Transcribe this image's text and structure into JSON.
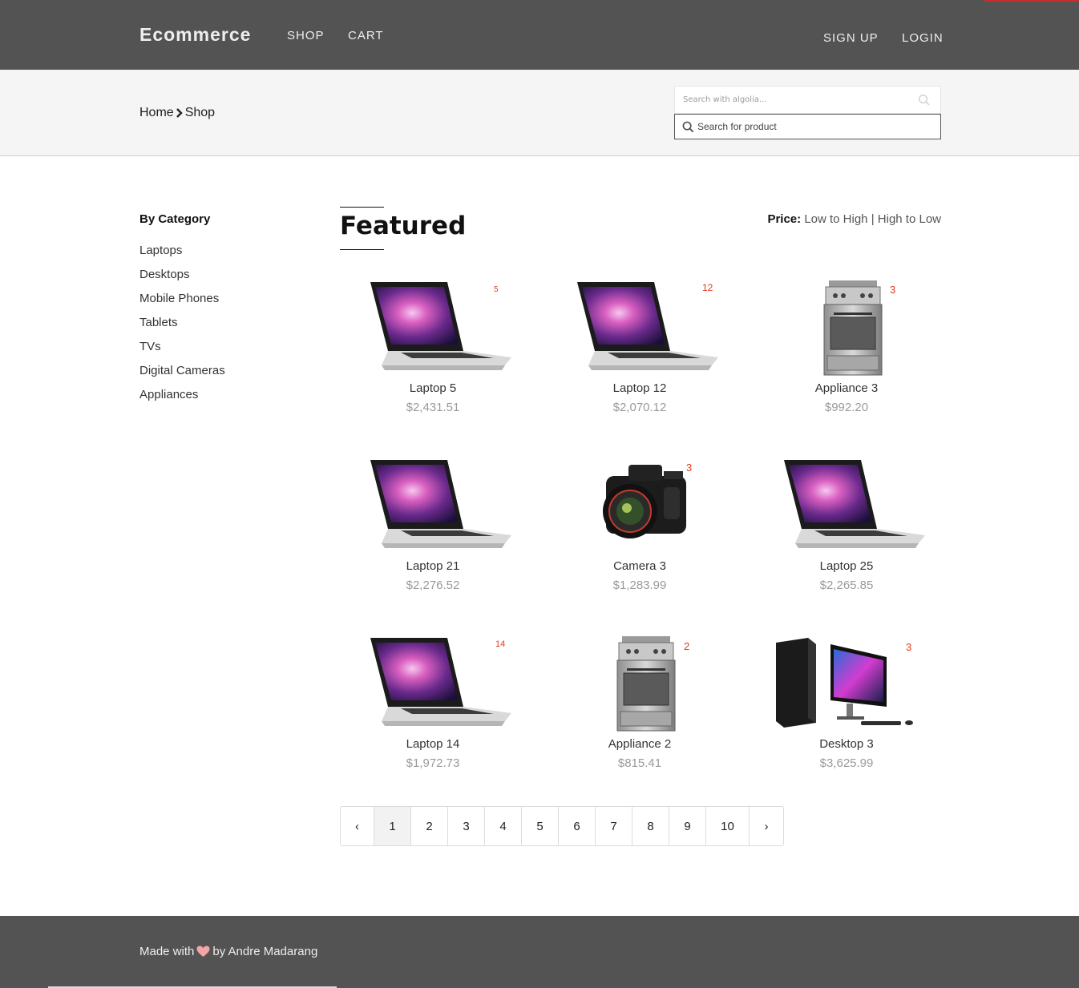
{
  "nav": {
    "brand": "Ecommerce",
    "shop": "SHOP",
    "cart": "CART",
    "signup": "SIGN UP",
    "login": "LOGIN"
  },
  "breadcrumb": {
    "home": "Home",
    "current": "Shop"
  },
  "search": {
    "algolia_placeholder": "Search with algolia...",
    "product_placeholder": "Search for product"
  },
  "sidebar": {
    "title": "By Category",
    "categories": [
      "Laptops",
      "Desktops",
      "Mobile Phones",
      "Tablets",
      "TVs",
      "Digital Cameras",
      "Appliances"
    ]
  },
  "main": {
    "heading": "Featured",
    "sort_label": "Price:",
    "sort_low": "Low to High",
    "sort_sep": "|",
    "sort_high": "High to Low"
  },
  "products": [
    {
      "name": "Laptop 5",
      "price": "$2,431.51",
      "badge": "5",
      "kind": "laptop"
    },
    {
      "name": "Laptop 12",
      "price": "$2,070.12",
      "badge": "12",
      "kind": "laptop"
    },
    {
      "name": "Appliance 3",
      "price": "$992.20",
      "badge": "3",
      "kind": "stove"
    },
    {
      "name": "Laptop 21",
      "price": "$2,276.52",
      "badge": "",
      "kind": "laptop"
    },
    {
      "name": "Camera 3",
      "price": "$1,283.99",
      "badge": "3",
      "kind": "camera"
    },
    {
      "name": "Laptop 25",
      "price": "$2,265.85",
      "badge": "",
      "kind": "laptop"
    },
    {
      "name": "Laptop 14",
      "price": "$1,972.73",
      "badge": "14",
      "kind": "laptop"
    },
    {
      "name": "Appliance 2",
      "price": "$815.41",
      "badge": "2",
      "kind": "stove"
    },
    {
      "name": "Desktop 3",
      "price": "$3,625.99",
      "badge": "3",
      "kind": "desktop"
    }
  ],
  "pagination": {
    "prev": "‹",
    "next": "›",
    "pages": [
      "1",
      "2",
      "3",
      "4",
      "5",
      "6",
      "7",
      "8",
      "9",
      "10"
    ],
    "current": "1"
  },
  "footer": {
    "made_with": "Made with",
    "by": "by Andre Madarang"
  },
  "colors": {
    "header_bg": "#535353",
    "accent_red": "#c9302c",
    "badge_red": "#e03c1d",
    "heart": "#f4a6a6"
  }
}
